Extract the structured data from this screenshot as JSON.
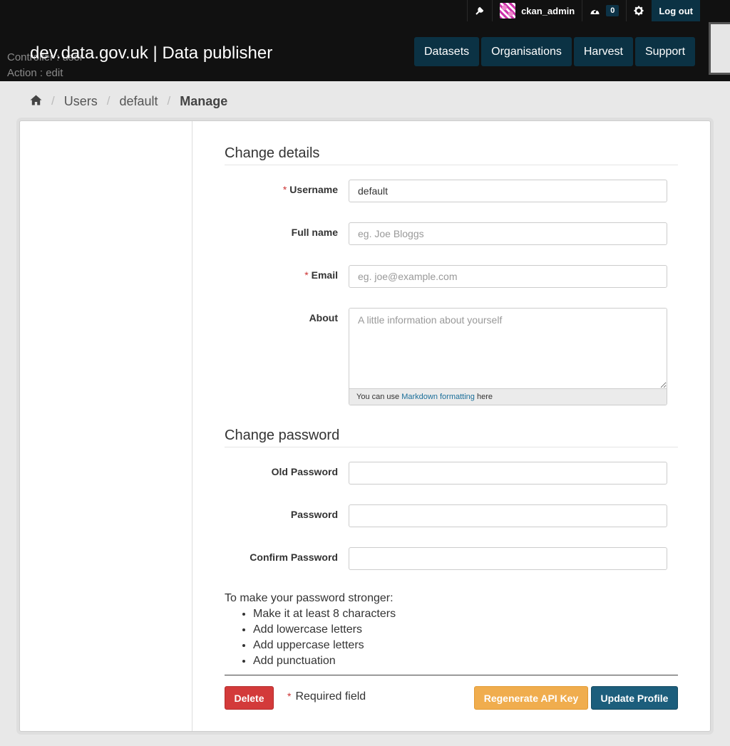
{
  "header": {
    "site_title": "dev.data.gov.uk | Data publisher",
    "debug_controller": "Controller : user",
    "debug_action": "Action : edit",
    "account": {
      "username": "ckan_admin",
      "dashboard_count": "0",
      "logout_label": "Log out"
    },
    "nav": [
      "Datasets",
      "Organisations",
      "Harvest",
      "Support"
    ]
  },
  "breadcrumb": {
    "items": [
      "Users",
      "default"
    ],
    "active": "Manage"
  },
  "form": {
    "details_heading": "Change details",
    "username": {
      "label": "Username",
      "value": "default",
      "required": "*"
    },
    "fullname": {
      "label": "Full name",
      "placeholder": "eg. Joe Bloggs"
    },
    "email": {
      "label": "Email",
      "placeholder": "eg. joe@example.com",
      "required": "*"
    },
    "about": {
      "label": "About",
      "placeholder": "A little information about yourself",
      "hint_prefix": "You can use ",
      "hint_link": "Markdown formatting",
      "hint_suffix": " here"
    },
    "password_heading": "Change password",
    "old_password": {
      "label": "Old Password"
    },
    "password": {
      "label": "Password"
    },
    "confirm_password": {
      "label": "Confirm Password"
    },
    "tips_intro": "To make your password stronger:",
    "tips": [
      "Make it at least 8 characters",
      "Add lowercase letters",
      "Add uppercase letters",
      "Add punctuation"
    ],
    "delete_label": "Delete",
    "required_marker": "*",
    "required_note": "Required field",
    "regenerate_label": "Regenerate API Key",
    "update_label": "Update Profile"
  },
  "icons": {
    "wrench": "wrench-icon",
    "dashboard": "dashboard-icon",
    "settings": "gear-icon",
    "home": "home-icon"
  },
  "colors": {
    "header_bg": "#111111",
    "nav_bg": "#0b3244",
    "delete": "#d33a3a",
    "regenerate": "#f0ad4e",
    "update": "#1c5e7c",
    "link": "#1b6f9a"
  }
}
